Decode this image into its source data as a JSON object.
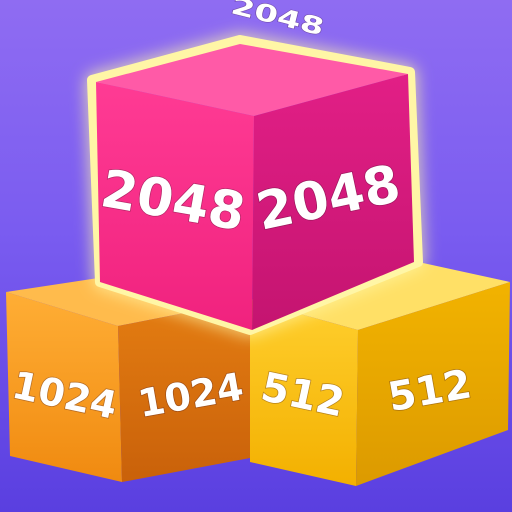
{
  "game": {
    "background_top": "#8f6cf2",
    "background_bottom": "#5a3fe0",
    "cubes": [
      {
        "id": "cube-1024",
        "value_left": "1024",
        "value_right": "1024",
        "colors": {
          "left": "#ff9a1f",
          "right": "#d8700f",
          "top": "#ffb94a"
        }
      },
      {
        "id": "cube-512",
        "value_left": "512",
        "value_right": "512",
        "colors": {
          "left": "#ffc21a",
          "right": "#e9a400",
          "top": "#ffe066"
        }
      },
      {
        "id": "cube-2048",
        "value_top": "2048",
        "value_left": "2048",
        "value_right": "2048",
        "colors": {
          "left": "#ff2a8a",
          "right": "#d3197a",
          "top": "#ff5aa5",
          "glow": "#fff3a0"
        }
      }
    ]
  }
}
